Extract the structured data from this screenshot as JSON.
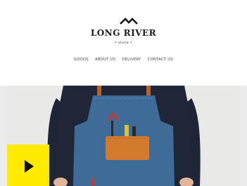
{
  "brand": {
    "name": "LONG RIVER",
    "subtitle": "• store •",
    "logo_icon": "mountain-wave-icon"
  },
  "nav": {
    "items": [
      {
        "label": "GOODS"
      },
      {
        "label": "ABOUT US"
      },
      {
        "label": "DELIVERY"
      },
      {
        "label": "CONTACT US"
      }
    ]
  },
  "hero": {
    "play_icon": "play-icon",
    "accent_color": "#ffea00"
  },
  "colors": {
    "header_bg": "#ffffff",
    "hero_bg": "#e9e9e7",
    "apron": "#3f6b99",
    "pocket": "#d27a2e",
    "shirt": "#1e2535"
  }
}
